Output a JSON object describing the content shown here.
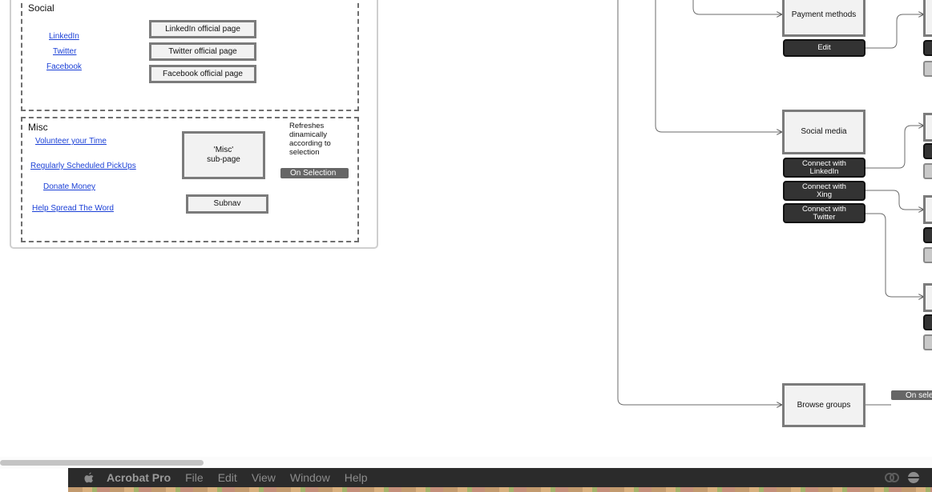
{
  "social": {
    "title": "Social",
    "links": [
      "LinkedIn",
      "Twitter",
      "Facebook"
    ],
    "pages": [
      "LinkedIn official page",
      "Twitter official page",
      "Facebook official page"
    ]
  },
  "misc": {
    "title": "Misc",
    "links": [
      "Volunteer your Time",
      "Regularly Scheduled PickUps",
      "Donate Money",
      "Help Spread The Word"
    ],
    "subpage": "'Misc'\nsub-page",
    "note": "Refreshes\ndinamically\naccording to\nselection",
    "on_selection": "On Selection",
    "subnav": "Subnav"
  },
  "flow": {
    "payment_methods": "Payment methods",
    "edit": "Edit",
    "social_media": "Social media",
    "connect_linkedin": "Connect with\nLinkedIn",
    "connect_xing": "Connect with\nXing",
    "connect_twitter": "Connect with\nTwitter",
    "browse_groups": "Browse groups",
    "on_select_tag": "On sele"
  },
  "menubar": {
    "app": "Acrobat Pro",
    "items": [
      "File",
      "Edit",
      "View",
      "Window",
      "Help"
    ]
  },
  "colors": {
    "link": "#1a3fd6",
    "dark_button": "#333333",
    "box_border": "#7b7b7b",
    "menubar": "#2b2b2b"
  }
}
